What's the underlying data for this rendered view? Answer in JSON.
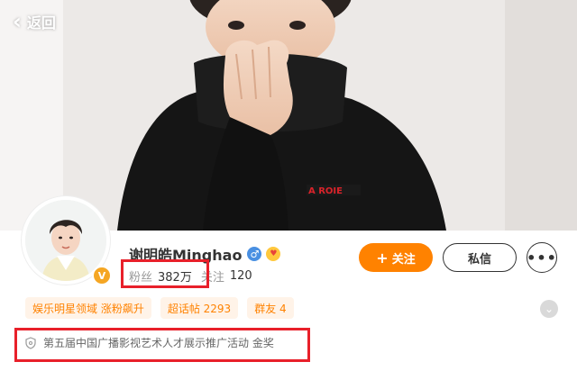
{
  "nav": {
    "back_label": "返回",
    "back_icon": "chevron-left-icon"
  },
  "profile": {
    "name": "谢明皓Minghao",
    "gender_icon": "male-icon",
    "emoji_icon": "emoji-face-icon",
    "verified_icon": "verified-v-icon",
    "verified_badge_text": "V",
    "fans_label": "粉丝",
    "fans_count": "382万",
    "following_label": "关注",
    "following_count": "120"
  },
  "actions": {
    "follow_label": "关注",
    "follow_icon": "plus-icon",
    "message_label": "私信",
    "more_icon": "more-dots-icon"
  },
  "tags": [
    {
      "label": "娱乐明星领域 涨粉飙升"
    },
    {
      "label": "超话帖 2293"
    },
    {
      "label": "群友 4"
    }
  ],
  "expand_icon": "chevron-down-icon",
  "award": {
    "icon": "shield-icon",
    "text": "第五届中国广播影视艺术人才展示推广活动 金奖"
  },
  "colors": {
    "accent": "#ff8200",
    "highlight": "#e8202a",
    "tag_bg": "#fff3e8"
  }
}
